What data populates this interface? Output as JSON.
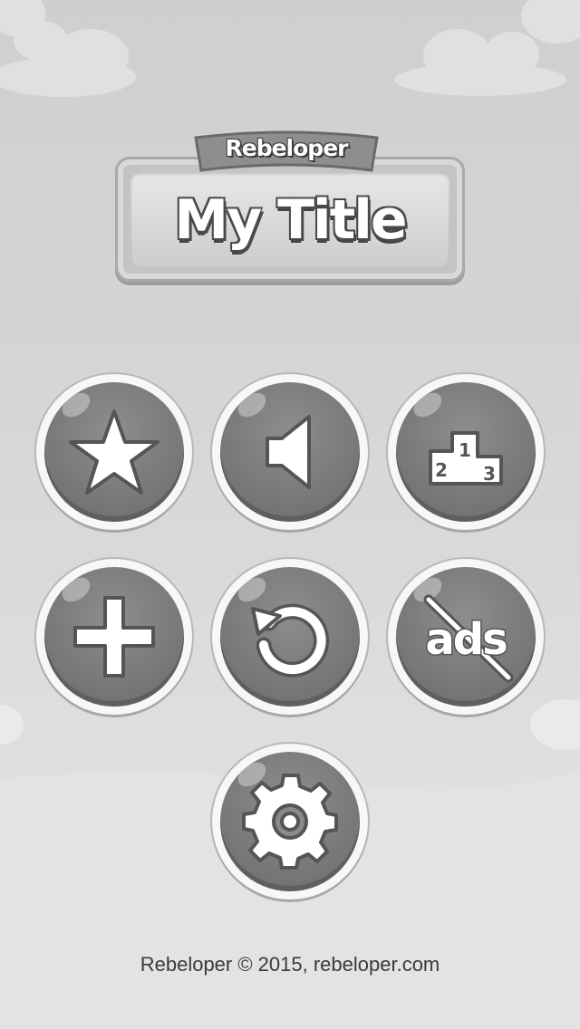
{
  "header": {
    "ribbon_label": "Rebeloper",
    "title": "My Title"
  },
  "buttons": [
    {
      "name": "rate-button",
      "icon": "star-icon"
    },
    {
      "name": "sound-button",
      "icon": "speaker-icon"
    },
    {
      "name": "leaderboard-button",
      "icon": "podium-icon",
      "podium_labels": [
        "1",
        "2",
        "3"
      ]
    },
    {
      "name": "more-button",
      "icon": "plus-icon"
    },
    {
      "name": "restore-button",
      "icon": "restore-icon"
    },
    {
      "name": "remove-ads-button",
      "icon": "no-ads-icon",
      "label": "ads"
    },
    {
      "name": "settings-button",
      "icon": "gear-icon"
    }
  ],
  "footer": {
    "text": "Rebeloper © 2015, rebeloper.com"
  },
  "colors": {
    "button_face": "#7a7a7a",
    "button_rim": "#f7f7f7",
    "background": "#d6d6d6"
  }
}
